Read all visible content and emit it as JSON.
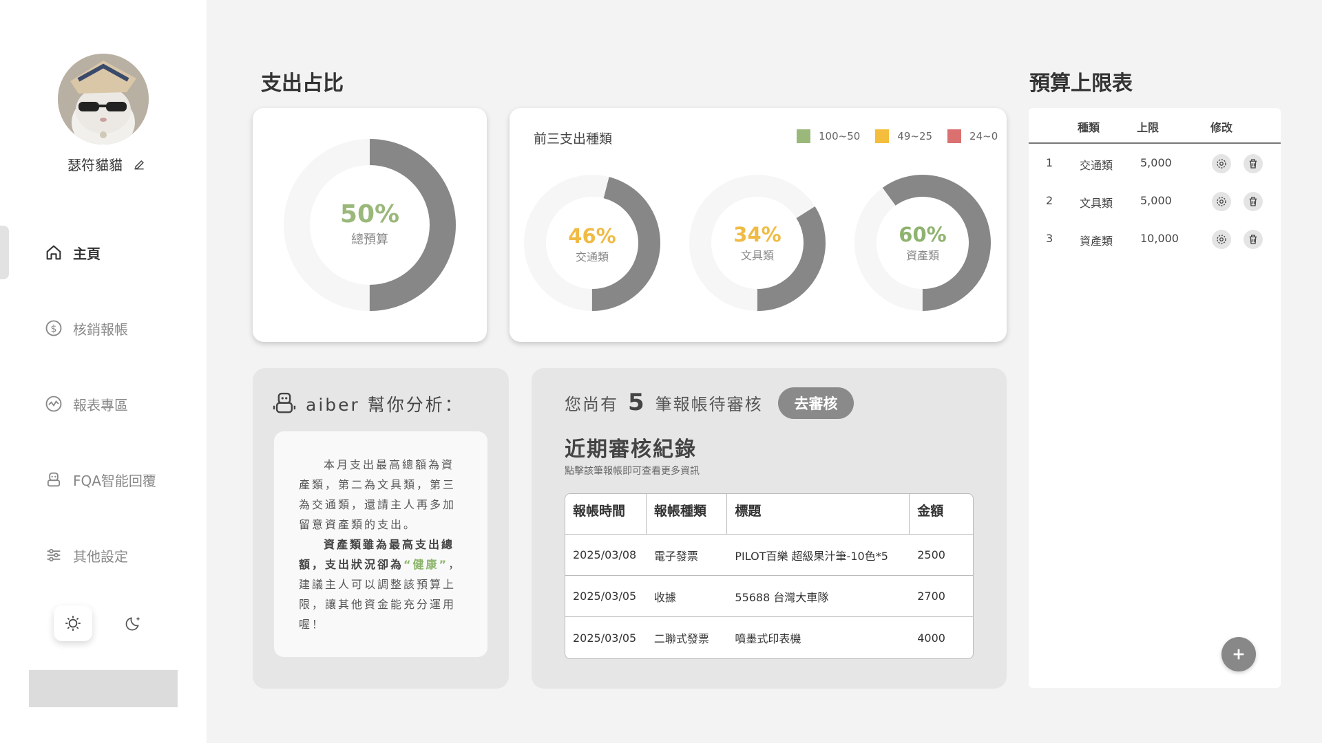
{
  "user": {
    "name": "瑟符貓貓"
  },
  "nav": {
    "home": "主頁",
    "reimburse": "核銷報帳",
    "reports": "報表專區",
    "faq": "FQA智能回覆",
    "settings": "其他設定"
  },
  "expense": {
    "title": "支出占比",
    "total": {
      "pct": "50%",
      "label": "總預算",
      "value": 50
    },
    "top3_title": "前三支出種類",
    "legend": [
      {
        "label": "100~50",
        "color": "#9ab87a"
      },
      {
        "label": "49~25",
        "color": "#f5bd3c"
      },
      {
        "label": "24~0",
        "color": "#db7070"
      }
    ],
    "categories": [
      {
        "pct": "46%",
        "label": "交通類",
        "value": 46,
        "color": "#f0bb45"
      },
      {
        "pct": "34%",
        "label": "文具類",
        "value": 34,
        "color": "#f0bb45"
      },
      {
        "pct": "60%",
        "label": "資產類",
        "value": 60,
        "color": "#8fb36f"
      }
    ]
  },
  "aiber": {
    "title": "aiber 幫你分析：",
    "para1": "本月支出最高總額為資產類，第二為文具類，第三為交通類，還請主人再多加留意資產類的支出。",
    "para2_bold": "資產類雖為最高支出總額，支出狀況卻為",
    "para2_hl": "“健康”",
    "para2_rest": "，建議主人可以調整該預算上限，讓其他資金能充分運用喔！"
  },
  "review": {
    "pending_prefix": "您尚有",
    "pending_count": "5",
    "pending_suffix": "筆報帳待審核",
    "button": "去審核",
    "recent_title": "近期審核紀錄",
    "hint": "點擊該筆報帳即可查看更多資訊",
    "headers": [
      "報帳時間",
      "報帳種類",
      "標題",
      "金額"
    ],
    "rows": [
      [
        "2025/03/08",
        "電子發票",
        "PILOT百樂 超級果汁筆-10色*5",
        "2500"
      ],
      [
        "2025/03/05",
        "收據",
        "55688 台灣大車隊",
        "2700"
      ],
      [
        "2025/03/05",
        "二聯式發票",
        "噴墨式印表機",
        "4000"
      ]
    ]
  },
  "budget": {
    "title": "預算上限表",
    "headers": {
      "type": "種類",
      "limit": "上限",
      "edit": "修改"
    },
    "rows": [
      {
        "no": "1",
        "type": "交通類",
        "limit": "5,000"
      },
      {
        "no": "2",
        "type": "文具類",
        "limit": "5,000"
      },
      {
        "no": "3",
        "type": "資產類",
        "limit": "10,000"
      }
    ]
  },
  "icons": [
    "home-icon",
    "dollar-icon",
    "chart-icon",
    "robot-icon",
    "sliders-icon",
    "sun-icon",
    "moon-icon",
    "edit-icon",
    "gear-icon",
    "trash-icon",
    "plus-icon"
  ]
}
